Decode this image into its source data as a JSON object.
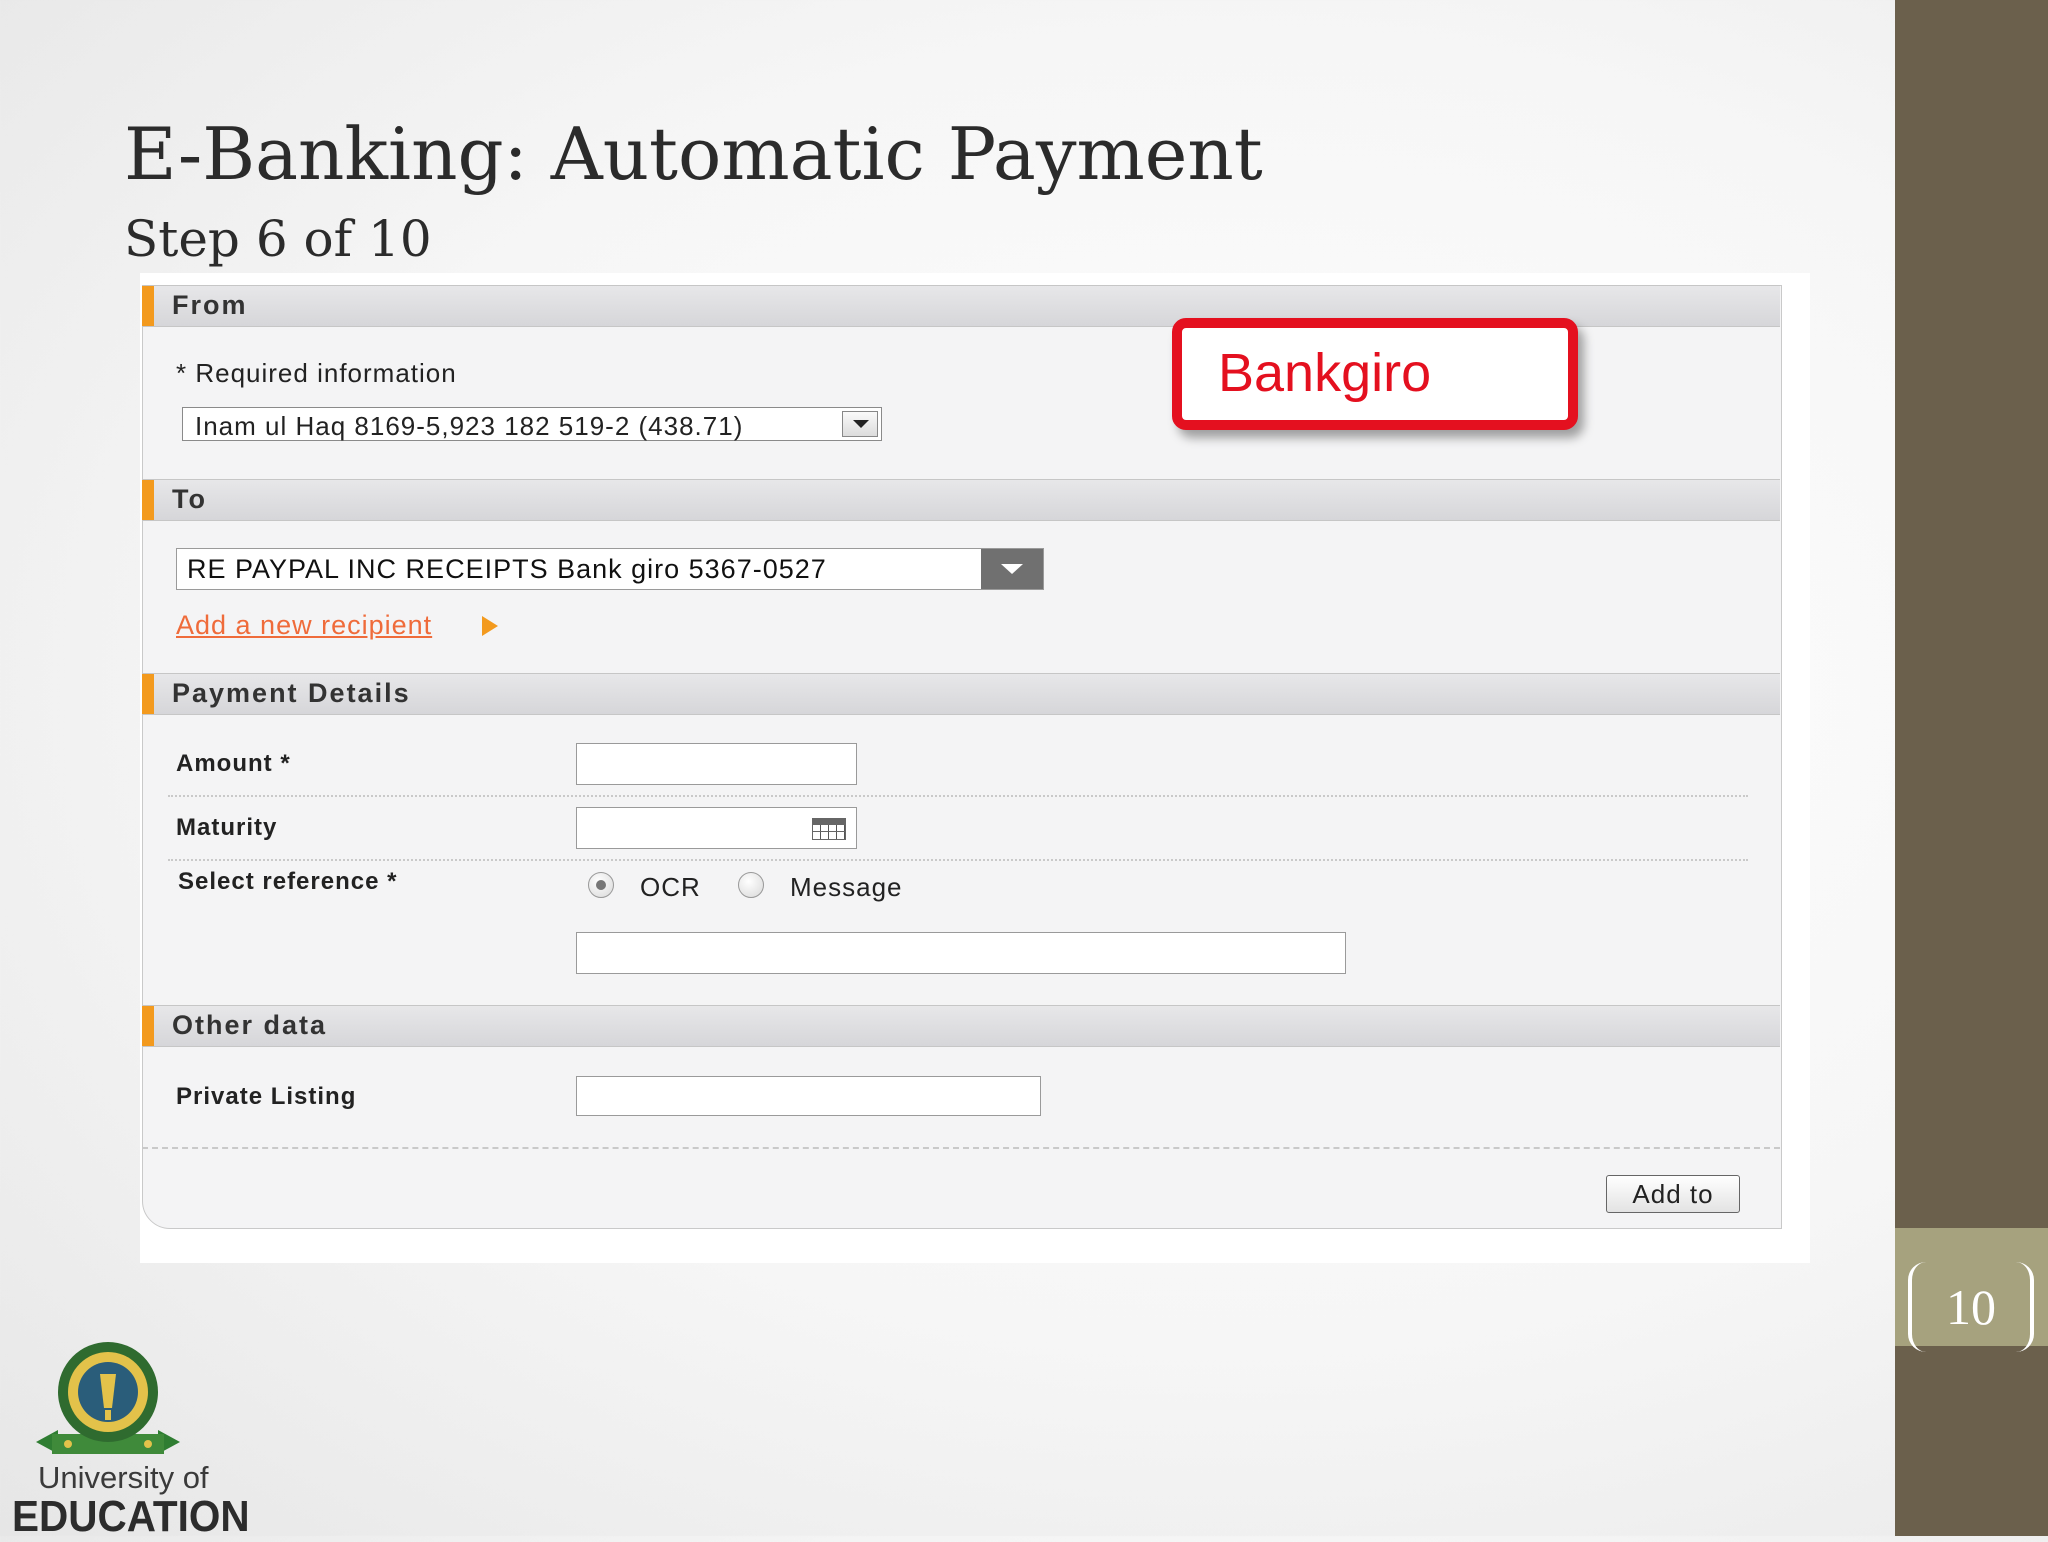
{
  "slide": {
    "title": "E-Banking: Automatic Payment",
    "subtitle": "Step 6 of 10",
    "page_number": "10"
  },
  "sections": {
    "from": "From",
    "to": "To",
    "payment_details": "Payment Details",
    "other_data": "Other data"
  },
  "from": {
    "required_info": "* Required information",
    "account_value": "Inam ul Haq 8169-5,923 182 519-2 (438.71)"
  },
  "to": {
    "recipient_value": "RE PAYPAL INC RECEIPTS Bank giro 5367-0527",
    "add_recipient_link": "Add a new recipient "
  },
  "payment": {
    "amount_label": "Amount *",
    "maturity_label": "Maturity",
    "select_reference_label": "Select reference *",
    "radio_ocr": "OCR",
    "radio_message": "Message",
    "selected_reference": "OCR"
  },
  "other": {
    "private_listing_label": "Private Listing"
  },
  "actions": {
    "add_to": "Add to"
  },
  "callout": {
    "text": "Bankgiro",
    "color": "#e4101f"
  },
  "logo": {
    "line1": "University of",
    "line2": "EDUCATION"
  },
  "colors": {
    "accent_orange": "#f39a1e",
    "link": "#ef6b3a",
    "sidebar": "#6b604c",
    "page_box": "#a6a27e"
  }
}
